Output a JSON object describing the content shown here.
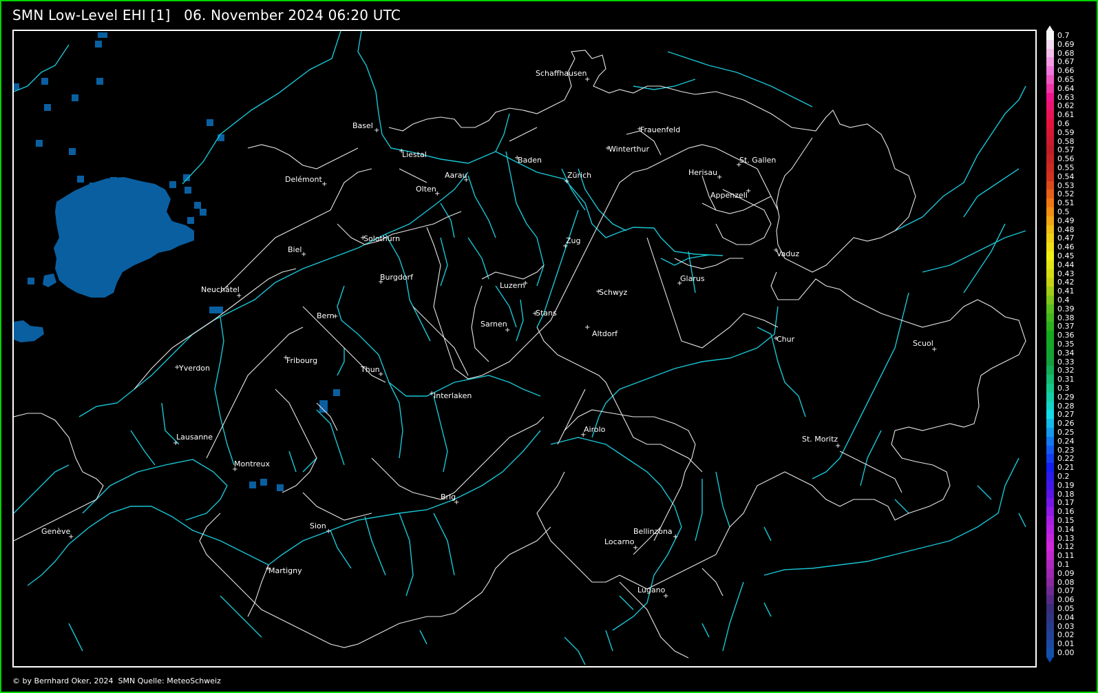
{
  "title": "SMN Low-Level EHI [1]   06. November 2024 06:20 UTC",
  "footer": "© by Bernhard Oker, 2024  SMN Quelle: MeteoSchweiz",
  "colors": {
    "frame": "#00d400",
    "border_lines": "#e8e8e8",
    "rivers": "#19c6d6",
    "field": "#0a5fa0"
  },
  "cities": [
    {
      "name": "Schaffhausen"
    },
    {
      "name": "Basel"
    },
    {
      "name": "Liestal"
    },
    {
      "name": "Frauenfeld"
    },
    {
      "name": "Winterthur"
    },
    {
      "name": "Baden"
    },
    {
      "name": "Aarau"
    },
    {
      "name": "Delémont"
    },
    {
      "name": "Olten"
    },
    {
      "name": "Zürich"
    },
    {
      "name": "Herisau"
    },
    {
      "name": "St. Gallen"
    },
    {
      "name": "Appenzell"
    },
    {
      "name": "Solothurn"
    },
    {
      "name": "Zug"
    },
    {
      "name": "Biel"
    },
    {
      "name": "Vaduz"
    },
    {
      "name": "Burgdorf"
    },
    {
      "name": "Glarus"
    },
    {
      "name": "Luzern"
    },
    {
      "name": "Neuchâtel"
    },
    {
      "name": "Schwyz"
    },
    {
      "name": "Bern"
    },
    {
      "name": "Stans"
    },
    {
      "name": "Sarnen"
    },
    {
      "name": "Altdorf"
    },
    {
      "name": "Chur"
    },
    {
      "name": "Scuol"
    },
    {
      "name": "Fribourg"
    },
    {
      "name": "Yverdon"
    },
    {
      "name": "Thun"
    },
    {
      "name": "Interlaken"
    },
    {
      "name": "Airolo"
    },
    {
      "name": "Lausanne"
    },
    {
      "name": "St. Moritz"
    },
    {
      "name": "Montreux"
    },
    {
      "name": "Brig"
    },
    {
      "name": "Sion"
    },
    {
      "name": "Bellinzona"
    },
    {
      "name": "Genève"
    },
    {
      "name": "Locarno"
    },
    {
      "name": "Martigny"
    },
    {
      "name": "Lugano"
    }
  ],
  "legend": {
    "values": [
      "0.7",
      "0.69",
      "0.68",
      "0.67",
      "0.66",
      "0.65",
      "0.64",
      "0.63",
      "0.62",
      "0.61",
      "0.6",
      "0.59",
      "0.58",
      "0.57",
      "0.56",
      "0.55",
      "0.54",
      "0.53",
      "0.52",
      "0.51",
      "0.5",
      "0.49",
      "0.48",
      "0.47",
      "0.46",
      "0.45",
      "0.44",
      "0.43",
      "0.42",
      "0.41",
      "0.4",
      "0.39",
      "0.38",
      "0.37",
      "0.36",
      "0.35",
      "0.34",
      "0.33",
      "0.32",
      "0.31",
      "0.3",
      "0.29",
      "0.28",
      "0.27",
      "0.26",
      "0.25",
      "0.24",
      "0.23",
      "0.22",
      "0.21",
      "0.2",
      "0.19",
      "0.18",
      "0.17",
      "0.16",
      "0.15",
      "0.14",
      "0.13",
      "0.12",
      "0.11",
      "0.1",
      "0.09",
      "0.08",
      "0.07",
      "0.06",
      "0.05",
      "0.04",
      "0.03",
      "0.02",
      "0.01",
      "0.00"
    ]
  }
}
